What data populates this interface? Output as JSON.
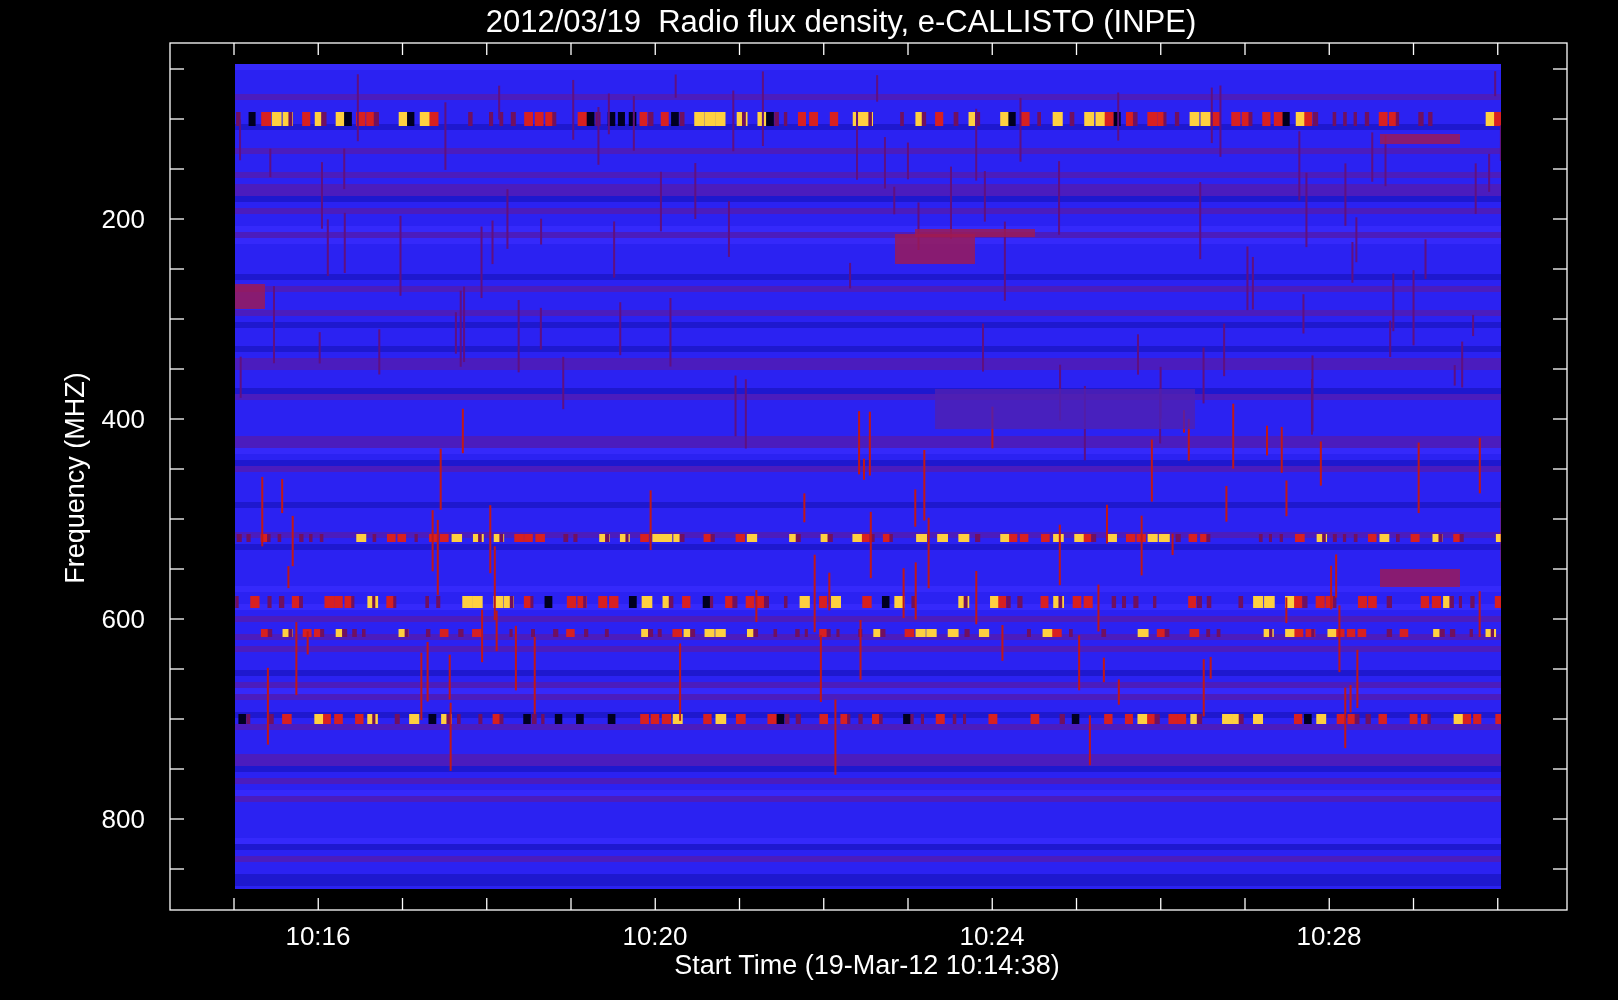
{
  "chart": {
    "title": "2012/03/19  Radio flux density, e-CALLISTO (INPE)",
    "xlabel": "Start Time (19-Mar-12 10:14:38)",
    "ylabel": "Frequency (MHZ)",
    "xticks": [
      "10:16",
      "10:20",
      "10:24",
      "10:28"
    ],
    "yticks": [
      "200",
      "400",
      "600",
      "800"
    ]
  }
}
